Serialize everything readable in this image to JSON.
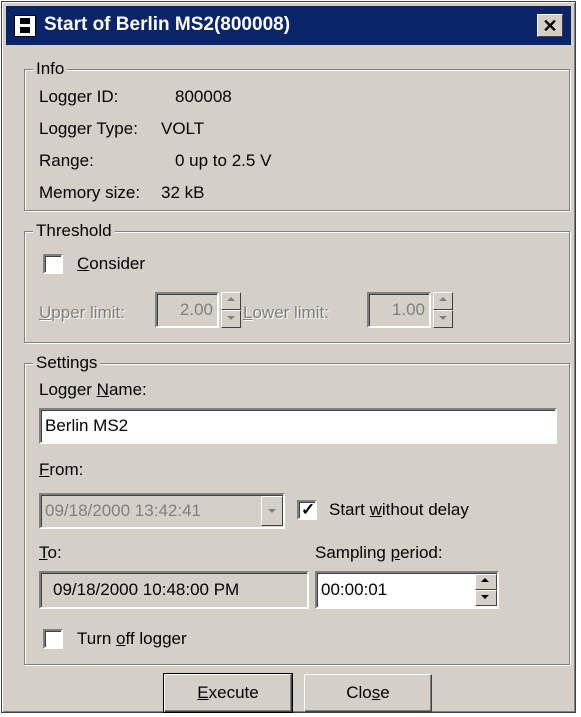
{
  "window": {
    "title": "Start of Berlin MS2(800008)",
    "close_label": "✕"
  },
  "info": {
    "legend": "Info",
    "logger_id_label": "Logger ID:",
    "logger_id_value": "800008",
    "logger_type_label": "Logger Type:",
    "logger_type_value": "VOLT",
    "range_label": "Range:",
    "range_value": "0 up to 2.5 V",
    "memory_label": "Memory size:",
    "memory_value": "32 kB"
  },
  "threshold": {
    "legend": "Threshold",
    "consider_label_u": "C",
    "consider_label_rest": "onsider",
    "consider_checked": false,
    "upper_label_u": "U",
    "upper_label_rest": "pper limit:",
    "upper_value": "2.00",
    "lower_label_u": "L",
    "lower_label_rest": "ower limit:",
    "lower_value": "1.00"
  },
  "settings": {
    "legend": "Settings",
    "name_label_a": "Logger ",
    "name_label_u": "N",
    "name_label_b": "ame:",
    "name_value": "Berlin MS2",
    "from_label_u": "F",
    "from_label_rest": "rom:",
    "from_value": "09/18/2000 13:42:41",
    "start_label_a": "Start ",
    "start_label_u": "w",
    "start_label_b": "ithout delay",
    "start_checked": true,
    "to_label_u": "T",
    "to_label_rest": "o:",
    "to_value": "09/18/2000 10:48:00 PM",
    "sampling_label_a": "Sampling ",
    "sampling_label_u": "p",
    "sampling_label_b": "eriod:",
    "sampling_value": "00:00:01",
    "turnoff_label_a": "Turn ",
    "turnoff_label_u": "o",
    "turnoff_label_b": "ff logger",
    "turnoff_checked": false
  },
  "buttons": {
    "execute_u": "E",
    "execute_rest": "xecute",
    "close_a": "Clo",
    "close_u": "s",
    "close_b": "e"
  },
  "colors": {
    "titlebar": "#0a246a",
    "face": "#d4d0c8"
  }
}
